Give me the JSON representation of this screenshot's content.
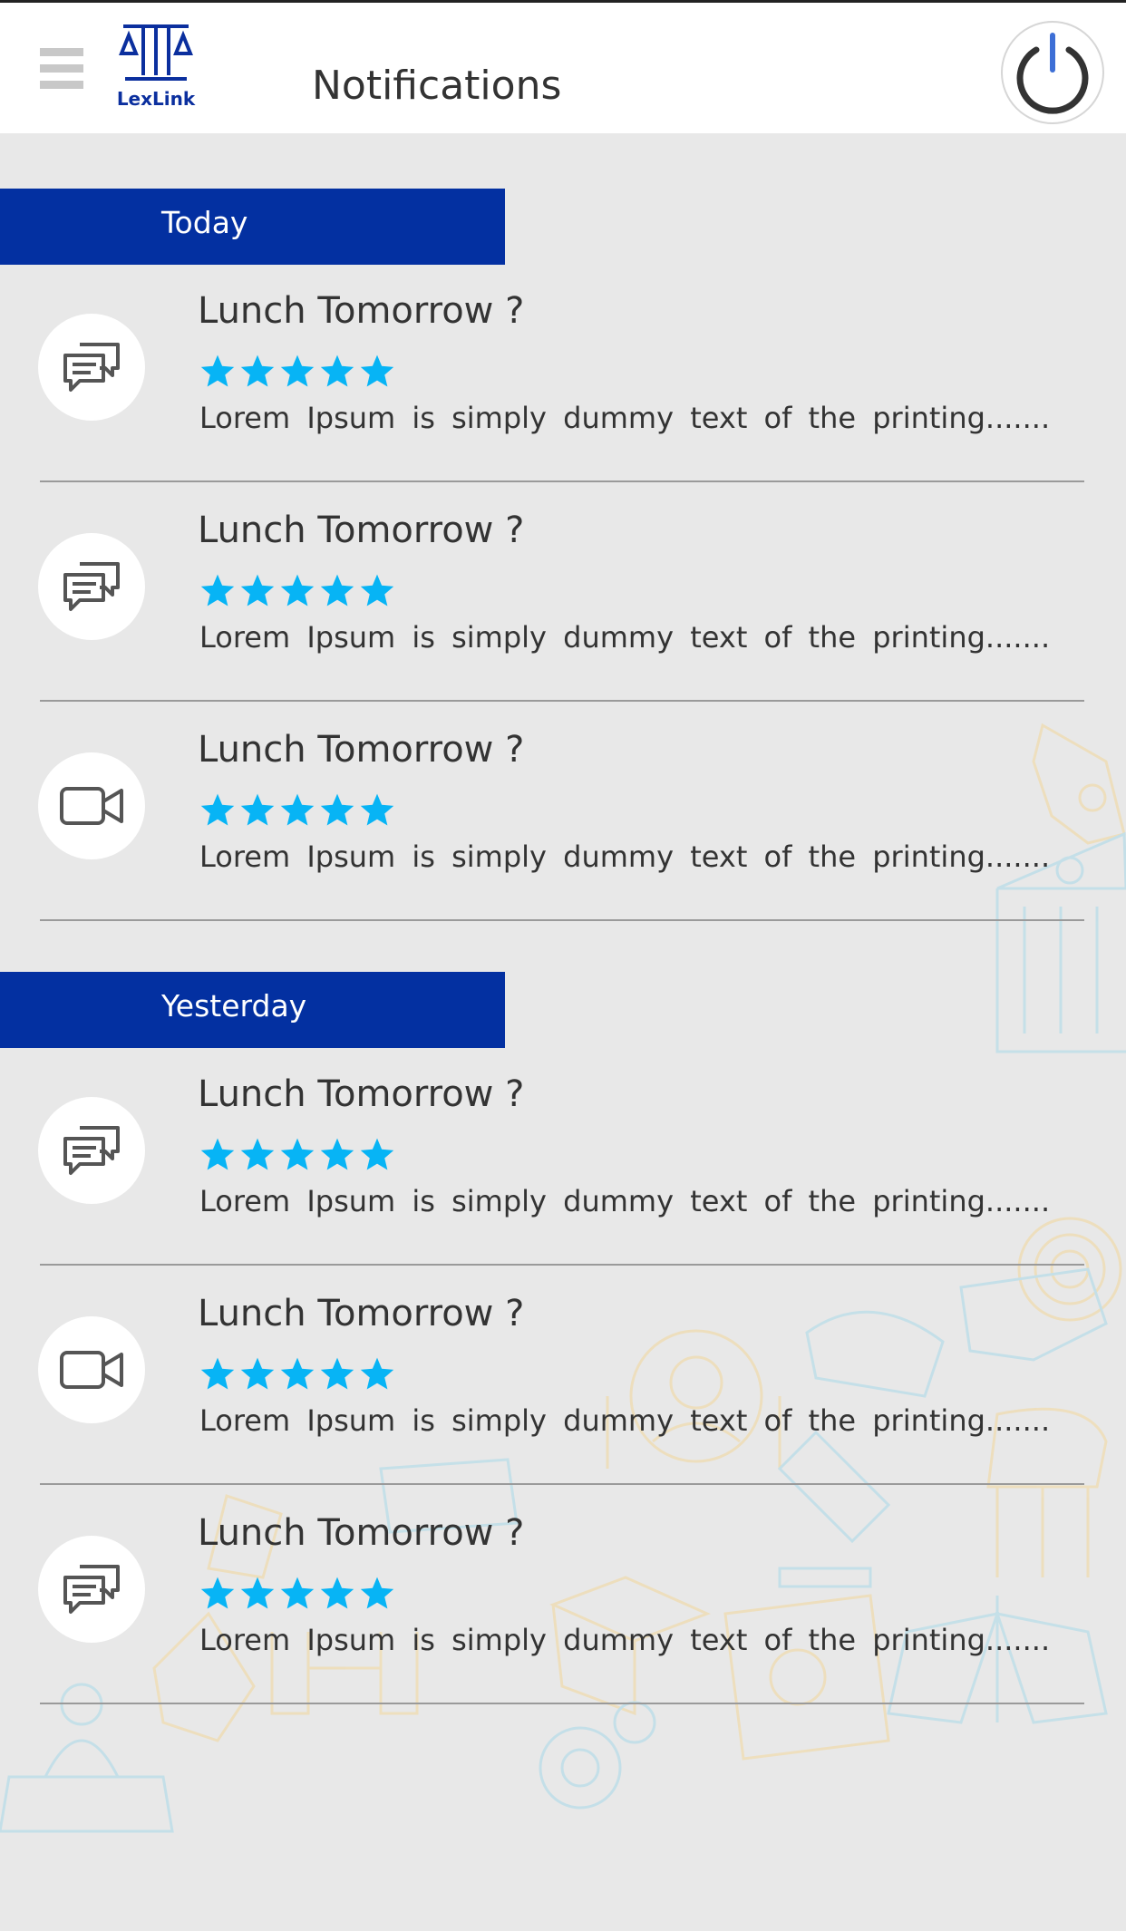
{
  "header": {
    "logo_text": "LexLink",
    "title": "Notifications"
  },
  "icons": {
    "menu": "hamburger-menu-icon",
    "power": "power-icon",
    "chat": "chat-bubbles-icon",
    "video": "video-camera-icon",
    "star": "star-icon"
  },
  "colors": {
    "section_bar": "#0330a1",
    "star": "#07b4f5",
    "background": "#e8e8e8"
  },
  "sections": [
    {
      "label": "Today",
      "items": [
        {
          "title": "Lunch Tomorrow ?",
          "rating": 5,
          "icon": "chat",
          "text": "Lorem Ipsum is simply dummy text of the printing......."
        },
        {
          "title": "Lunch Tomorrow ?",
          "rating": 5,
          "icon": "chat",
          "text": "Lorem Ipsum is simply dummy text of the printing......."
        },
        {
          "title": "Lunch Tomorrow ?",
          "rating": 5,
          "icon": "video",
          "text": "Lorem Ipsum is simply dummy text of the printing......."
        }
      ]
    },
    {
      "label": "Yesterday",
      "items": [
        {
          "title": "Lunch Tomorrow ?",
          "rating": 5,
          "icon": "chat",
          "text": "Lorem Ipsum is simply dummy text of the printing......."
        },
        {
          "title": "Lunch Tomorrow ?",
          "rating": 5,
          "icon": "video",
          "text": "Lorem Ipsum is simply dummy text of the printing......."
        },
        {
          "title": "Lunch Tomorrow ?",
          "rating": 5,
          "icon": "chat",
          "text": "Lorem Ipsum is simply dummy text of the printing......."
        }
      ]
    }
  ]
}
